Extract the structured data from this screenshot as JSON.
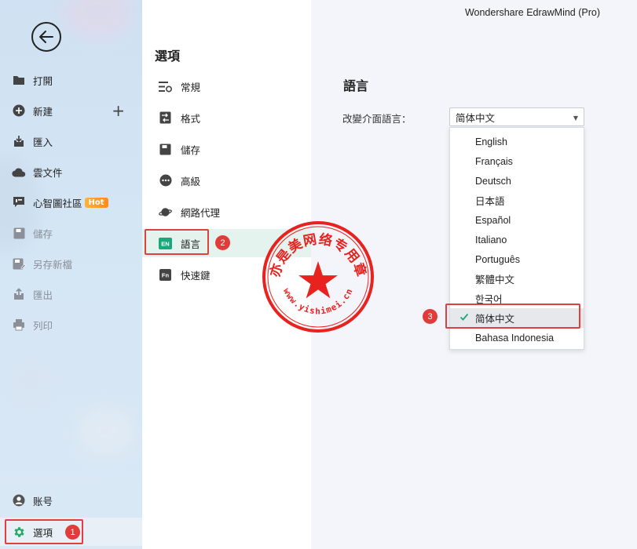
{
  "app": {
    "title": "Wondershare EdrawMind (Pro)"
  },
  "sidebar": {
    "items": [
      {
        "label": "打開",
        "icon": "folder-icon"
      },
      {
        "label": "新建",
        "icon": "add-circle-icon",
        "extra": "+"
      },
      {
        "label": "匯入",
        "icon": "import-icon"
      },
      {
        "label": "雲文件",
        "icon": "cloud-icon"
      },
      {
        "label": "心智圖社區",
        "icon": "community-icon",
        "badge": "Hot"
      },
      {
        "label": "儲存",
        "icon": "save-icon"
      },
      {
        "label": "另存新檔",
        "icon": "save-as-icon"
      },
      {
        "label": "匯出",
        "icon": "export-icon"
      },
      {
        "label": "列印",
        "icon": "print-icon"
      }
    ],
    "account": {
      "label": "账号",
      "icon": "user-icon"
    },
    "options": {
      "label": "選項",
      "icon": "gear-icon"
    }
  },
  "options_panel": {
    "title": "選項",
    "items": [
      {
        "label": "常規",
        "icon": "general-icon"
      },
      {
        "label": "格式",
        "icon": "format-icon"
      },
      {
        "label": "儲存",
        "icon": "save-icon"
      },
      {
        "label": "高級",
        "icon": "more-icon"
      },
      {
        "label": "網路代理",
        "icon": "planet-icon"
      },
      {
        "label": "語言",
        "icon": "EN"
      },
      {
        "label": "快速鍵",
        "icon": "Fn"
      }
    ]
  },
  "language": {
    "section_title": "語言",
    "change_label": "改變介面語言：",
    "selected": "简体中文",
    "options": [
      "English",
      "Français",
      "Deutsch",
      "日本語",
      "Español",
      "Italiano",
      "Português",
      "繁體中文",
      "한국어",
      "简体中文",
      "Bahasa Indonesia"
    ],
    "selected_index": 9
  },
  "annotations": {
    "step1": "1",
    "step2": "2",
    "step3": "3"
  },
  "stamp": {
    "text_top": "亦是美网络专用章",
    "text_bottom": "www.yishimei.cn",
    "color": "#e8221f"
  },
  "colors": {
    "accent_green": "#1aa87a",
    "highlight_red": "#e0403d",
    "gear_green": "#2aa86a"
  }
}
